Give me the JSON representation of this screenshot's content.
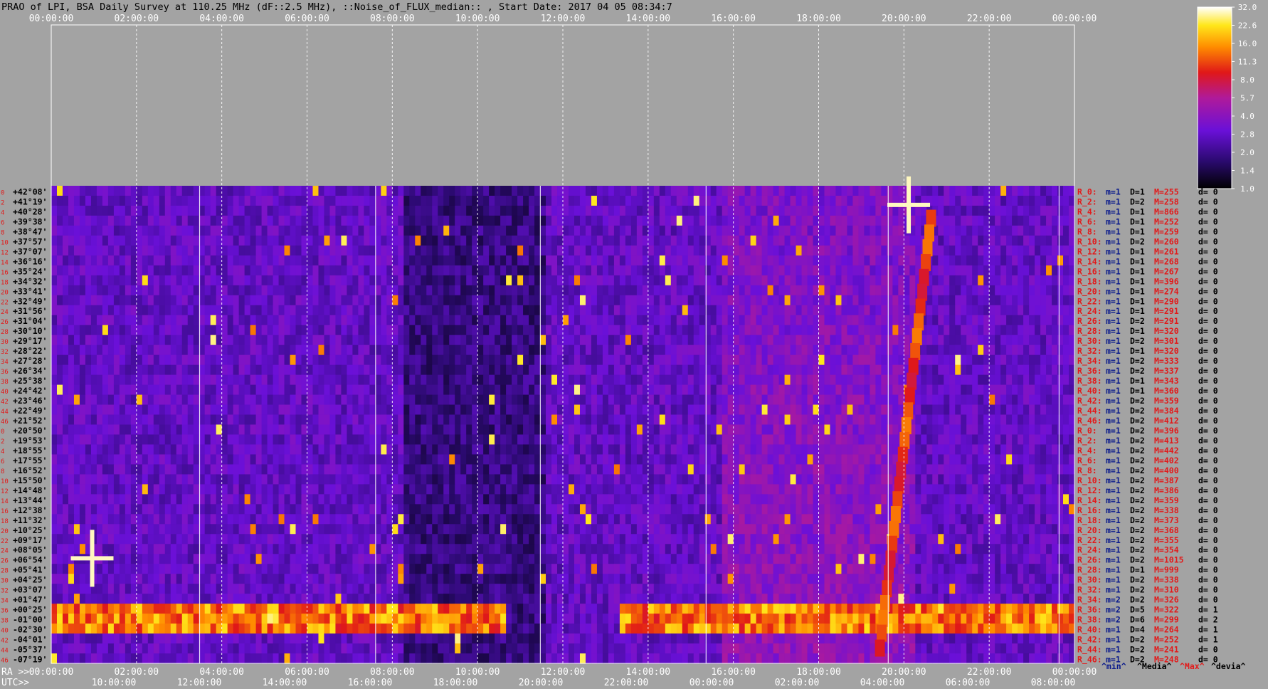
{
  "title": "PRAO of LPI, BSA Daily Survey at 110.25 MHz (dF::2.5 MHz), ::Noise_of_FLUX_median:: , Start Date: 2017 04 05 08:34:7",
  "colors": {
    "background": "#a3a3a3",
    "declination_label": "#000000",
    "row_index_label": "#e21a1a",
    "stats_red": "#e21a1a",
    "stats_blue": "#0a1a8c"
  },
  "chart_data": {
    "type": "heatmap",
    "colorscale": "gnuplot/heat (black-purple-red-yellow-white)",
    "colorbar": {
      "ticks": [
        "32.0",
        "22.6",
        "16.0",
        "11.3",
        "8.0",
        "5.7",
        "4.0",
        "2.8",
        "2.0",
        "1.4",
        "1.0"
      ],
      "min": 1.0,
      "max": 32.0,
      "scale": "log"
    },
    "top_time_ticks": [
      "00:00:00",
      "02:00:00",
      "04:00:00",
      "06:00:00",
      "08:00:00",
      "10:00:00",
      "12:00:00",
      "14:00:00",
      "16:00:00",
      "18:00:00",
      "20:00:00",
      "22:00:00",
      "00:00:00"
    ],
    "ra_ticks": [
      "00:00:00",
      "02:00:00",
      "04:00:00",
      "06:00:00",
      "08:00:00",
      "10:00:00",
      "12:00:00",
      "14:00:00",
      "16:00:00",
      "18:00:00",
      "20:00:00",
      "22:00:00",
      "00:00:00"
    ],
    "utc_ticks": [
      "10:00:00",
      "12:00:00",
      "14:00:00",
      "16:00:00",
      "18:00:00",
      "20:00:00",
      "22:00:00",
      "00:00:00",
      "02:00:00",
      "04:00:00",
      "06:00:00",
      "08:00:00"
    ],
    "ra_axis_label": "RA >>",
    "utc_axis_label": "UTC>>",
    "declinations": [
      "+42°08'",
      "+41°19'",
      "+40°28'",
      "+39°38'",
      "+38°47'",
      "+37°57'",
      "+37°07'",
      "+36°16'",
      "+35°24'",
      "+34°32'",
      "+33°41'",
      "+32°49'",
      "+31°56'",
      "+31°04'",
      "+30°10'",
      "+29°17'",
      "+28°22'",
      "+27°28'",
      "+26°34'",
      "+25°38'",
      "+24°42'",
      "+23°46'",
      "+22°49'",
      "+21°52'",
      "+20°50'",
      "+19°53'",
      "+18°55'",
      "+17°55'",
      "+16°52'",
      "+15°50'",
      "+14°48'",
      "+13°44'",
      "+12°38'",
      "+11°32'",
      "+10°25'",
      "+09°17'",
      "+08°05'",
      "+06°54'",
      "+05°41'",
      "+04°25'",
      "+03°07'",
      "+01°47'",
      "+00°25'",
      "-01°00'",
      "-02°30'",
      "-04°01'",
      "-05°37'",
      "-07°19'"
    ],
    "row_index_labels": [
      "0",
      "2",
      "4",
      "6",
      "8",
      "10",
      "12",
      "14",
      "16",
      "18",
      "20",
      "22",
      "24",
      "26",
      "28",
      "30",
      "32",
      "34",
      "36",
      "38",
      "40",
      "42",
      "44",
      "46",
      "0",
      "2",
      "4",
      "6",
      "8",
      "10",
      "12",
      "14",
      "16",
      "18",
      "20",
      "22",
      "24",
      "26",
      "28",
      "30",
      "32",
      "34",
      "36",
      "38",
      "40",
      "42",
      "44",
      "46"
    ],
    "row_stats": [
      {
        "r": "R_0:",
        "m": "m=1",
        "D": "D=1",
        "M": "M=255",
        "d": "d= 0"
      },
      {
        "r": "R_2:",
        "m": "m=1",
        "D": "D=2",
        "M": "M=258",
        "d": "d= 0"
      },
      {
        "r": "R_4:",
        "m": "m=1",
        "D": "D=1",
        "M": "M=866",
        "d": "d= 0"
      },
      {
        "r": "R_6:",
        "m": "m=1",
        "D": "D=1",
        "M": "M=252",
        "d": "d= 0"
      },
      {
        "r": "R_8:",
        "m": "m=1",
        "D": "D=1",
        "M": "M=259",
        "d": "d= 0"
      },
      {
        "r": "R_10:",
        "m": "m=1",
        "D": "D=2",
        "M": "M=260",
        "d": "d= 0"
      },
      {
        "r": "R_12:",
        "m": "m=1",
        "D": "D=1",
        "M": "M=261",
        "d": "d= 0"
      },
      {
        "r": "R_14:",
        "m": "m=1",
        "D": "D=1",
        "M": "M=268",
        "d": "d= 0"
      },
      {
        "r": "R_16:",
        "m": "m=1",
        "D": "D=1",
        "M": "M=267",
        "d": "d= 0"
      },
      {
        "r": "R_18:",
        "m": "m=1",
        "D": "D=1",
        "M": "M=396",
        "d": "d= 0"
      },
      {
        "r": "R_20:",
        "m": "m=1",
        "D": "D=1",
        "M": "M=274",
        "d": "d= 0"
      },
      {
        "r": "R_22:",
        "m": "m=1",
        "D": "D=1",
        "M": "M=290",
        "d": "d= 0"
      },
      {
        "r": "R_24:",
        "m": "m=1",
        "D": "D=1",
        "M": "M=291",
        "d": "d= 0"
      },
      {
        "r": "R_26:",
        "m": "m=1",
        "D": "D=2",
        "M": "M=291",
        "d": "d= 0"
      },
      {
        "r": "R_28:",
        "m": "m=1",
        "D": "D=1",
        "M": "M=320",
        "d": "d= 0"
      },
      {
        "r": "R_30:",
        "m": "m=1",
        "D": "D=2",
        "M": "M=301",
        "d": "d= 0"
      },
      {
        "r": "R_32:",
        "m": "m=1",
        "D": "D=1",
        "M": "M=320",
        "d": "d= 0"
      },
      {
        "r": "R_34:",
        "m": "m=1",
        "D": "D=2",
        "M": "M=333",
        "d": "d= 0"
      },
      {
        "r": "R_36:",
        "m": "m=1",
        "D": "D=2",
        "M": "M=337",
        "d": "d= 0"
      },
      {
        "r": "R_38:",
        "m": "m=1",
        "D": "D=1",
        "M": "M=343",
        "d": "d= 0"
      },
      {
        "r": "R_40:",
        "m": "m=1",
        "D": "D=1",
        "M": "M=360",
        "d": "d= 0"
      },
      {
        "r": "R_42:",
        "m": "m=1",
        "D": "D=2",
        "M": "M=359",
        "d": "d= 0"
      },
      {
        "r": "R_44:",
        "m": "m=1",
        "D": "D=2",
        "M": "M=384",
        "d": "d= 0"
      },
      {
        "r": "R_46:",
        "m": "m=1",
        "D": "D=2",
        "M": "M=412",
        "d": "d= 0"
      },
      {
        "r": "R_0:",
        "m": "m=1",
        "D": "D=2",
        "M": "M=396",
        "d": "d= 0"
      },
      {
        "r": "R_2:",
        "m": "m=1",
        "D": "D=2",
        "M": "M=413",
        "d": "d= 0"
      },
      {
        "r": "R_4:",
        "m": "m=1",
        "D": "D=2",
        "M": "M=442",
        "d": "d= 0"
      },
      {
        "r": "R_6:",
        "m": "m=1",
        "D": "D=2",
        "M": "M=402",
        "d": "d= 0"
      },
      {
        "r": "R_8:",
        "m": "m=1",
        "D": "D=2",
        "M": "M=400",
        "d": "d= 0"
      },
      {
        "r": "R_10:",
        "m": "m=1",
        "D": "D=2",
        "M": "M=387",
        "d": "d= 0"
      },
      {
        "r": "R_12:",
        "m": "m=1",
        "D": "D=2",
        "M": "M=386",
        "d": "d= 0"
      },
      {
        "r": "R_14:",
        "m": "m=1",
        "D": "D=2",
        "M": "M=359",
        "d": "d= 0"
      },
      {
        "r": "R_16:",
        "m": "m=1",
        "D": "D=2",
        "M": "M=338",
        "d": "d= 0"
      },
      {
        "r": "R_18:",
        "m": "m=1",
        "D": "D=2",
        "M": "M=373",
        "d": "d= 0"
      },
      {
        "r": "R_20:",
        "m": "m=1",
        "D": "D=2",
        "M": "M=368",
        "d": "d= 0"
      },
      {
        "r": "R_22:",
        "m": "m=1",
        "D": "D=2",
        "M": "M=355",
        "d": "d= 0"
      },
      {
        "r": "R_24:",
        "m": "m=1",
        "D": "D=2",
        "M": "M=354",
        "d": "d= 0"
      },
      {
        "r": "R_26:",
        "m": "m=1",
        "D": "D=2",
        "M": "M=1015",
        "d": "d= 0"
      },
      {
        "r": "R_28:",
        "m": "m=1",
        "D": "D=1",
        "M": "M=999",
        "d": "d= 0"
      },
      {
        "r": "R_30:",
        "m": "m=1",
        "D": "D=2",
        "M": "M=338",
        "d": "d= 0"
      },
      {
        "r": "R_32:",
        "m": "m=1",
        "D": "D=2",
        "M": "M=310",
        "d": "d= 0"
      },
      {
        "r": "R_34:",
        "m": "m=2",
        "D": "D=2",
        "M": "M=326",
        "d": "d= 0"
      },
      {
        "r": "R_36:",
        "m": "m=2",
        "D": "D=5",
        "M": "M=322",
        "d": "d= 1"
      },
      {
        "r": "R_38:",
        "m": "m=2",
        "D": "D=6",
        "M": "M=299",
        "d": "d= 2"
      },
      {
        "r": "R_40:",
        "m": "m=1",
        "D": "D=4",
        "M": "M=264",
        "d": "d= 1"
      },
      {
        "r": "R_42:",
        "m": "m=1",
        "D": "D=2",
        "M": "M=252",
        "d": "d= 1"
      },
      {
        "r": "R_44:",
        "m": "m=1",
        "D": "D=2",
        "M": "M=241",
        "d": "d= 0"
      },
      {
        "r": "R_46:",
        "m": "m=1",
        "D": "D=2",
        "M": "M=248",
        "d": "d= 0"
      }
    ],
    "stats_footer": [
      "^min^",
      "^Media^",
      "^Max^",
      "^devia^"
    ]
  }
}
